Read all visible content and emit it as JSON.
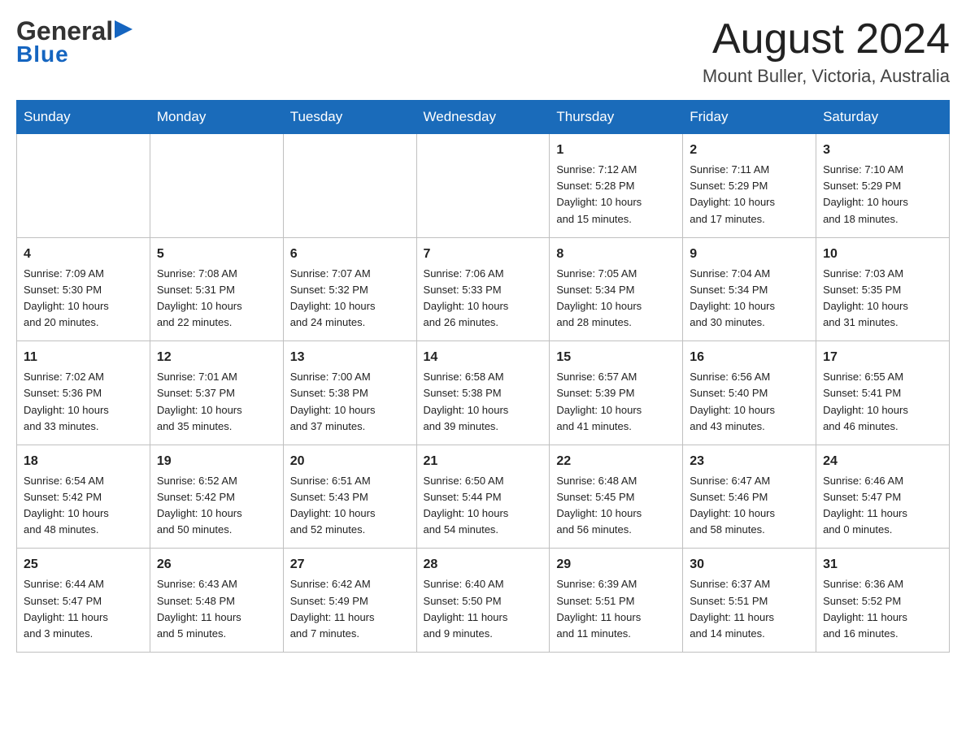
{
  "header": {
    "logo_general": "General",
    "logo_blue": "Blue",
    "month_title": "August 2024",
    "location": "Mount Buller, Victoria, Australia"
  },
  "days_of_week": [
    "Sunday",
    "Monday",
    "Tuesday",
    "Wednesday",
    "Thursday",
    "Friday",
    "Saturday"
  ],
  "weeks": [
    [
      {
        "day": "",
        "info": ""
      },
      {
        "day": "",
        "info": ""
      },
      {
        "day": "",
        "info": ""
      },
      {
        "day": "",
        "info": ""
      },
      {
        "day": "1",
        "info": "Sunrise: 7:12 AM\nSunset: 5:28 PM\nDaylight: 10 hours\nand 15 minutes."
      },
      {
        "day": "2",
        "info": "Sunrise: 7:11 AM\nSunset: 5:29 PM\nDaylight: 10 hours\nand 17 minutes."
      },
      {
        "day": "3",
        "info": "Sunrise: 7:10 AM\nSunset: 5:29 PM\nDaylight: 10 hours\nand 18 minutes."
      }
    ],
    [
      {
        "day": "4",
        "info": "Sunrise: 7:09 AM\nSunset: 5:30 PM\nDaylight: 10 hours\nand 20 minutes."
      },
      {
        "day": "5",
        "info": "Sunrise: 7:08 AM\nSunset: 5:31 PM\nDaylight: 10 hours\nand 22 minutes."
      },
      {
        "day": "6",
        "info": "Sunrise: 7:07 AM\nSunset: 5:32 PM\nDaylight: 10 hours\nand 24 minutes."
      },
      {
        "day": "7",
        "info": "Sunrise: 7:06 AM\nSunset: 5:33 PM\nDaylight: 10 hours\nand 26 minutes."
      },
      {
        "day": "8",
        "info": "Sunrise: 7:05 AM\nSunset: 5:34 PM\nDaylight: 10 hours\nand 28 minutes."
      },
      {
        "day": "9",
        "info": "Sunrise: 7:04 AM\nSunset: 5:34 PM\nDaylight: 10 hours\nand 30 minutes."
      },
      {
        "day": "10",
        "info": "Sunrise: 7:03 AM\nSunset: 5:35 PM\nDaylight: 10 hours\nand 31 minutes."
      }
    ],
    [
      {
        "day": "11",
        "info": "Sunrise: 7:02 AM\nSunset: 5:36 PM\nDaylight: 10 hours\nand 33 minutes."
      },
      {
        "day": "12",
        "info": "Sunrise: 7:01 AM\nSunset: 5:37 PM\nDaylight: 10 hours\nand 35 minutes."
      },
      {
        "day": "13",
        "info": "Sunrise: 7:00 AM\nSunset: 5:38 PM\nDaylight: 10 hours\nand 37 minutes."
      },
      {
        "day": "14",
        "info": "Sunrise: 6:58 AM\nSunset: 5:38 PM\nDaylight: 10 hours\nand 39 minutes."
      },
      {
        "day": "15",
        "info": "Sunrise: 6:57 AM\nSunset: 5:39 PM\nDaylight: 10 hours\nand 41 minutes."
      },
      {
        "day": "16",
        "info": "Sunrise: 6:56 AM\nSunset: 5:40 PM\nDaylight: 10 hours\nand 43 minutes."
      },
      {
        "day": "17",
        "info": "Sunrise: 6:55 AM\nSunset: 5:41 PM\nDaylight: 10 hours\nand 46 minutes."
      }
    ],
    [
      {
        "day": "18",
        "info": "Sunrise: 6:54 AM\nSunset: 5:42 PM\nDaylight: 10 hours\nand 48 minutes."
      },
      {
        "day": "19",
        "info": "Sunrise: 6:52 AM\nSunset: 5:42 PM\nDaylight: 10 hours\nand 50 minutes."
      },
      {
        "day": "20",
        "info": "Sunrise: 6:51 AM\nSunset: 5:43 PM\nDaylight: 10 hours\nand 52 minutes."
      },
      {
        "day": "21",
        "info": "Sunrise: 6:50 AM\nSunset: 5:44 PM\nDaylight: 10 hours\nand 54 minutes."
      },
      {
        "day": "22",
        "info": "Sunrise: 6:48 AM\nSunset: 5:45 PM\nDaylight: 10 hours\nand 56 minutes."
      },
      {
        "day": "23",
        "info": "Sunrise: 6:47 AM\nSunset: 5:46 PM\nDaylight: 10 hours\nand 58 minutes."
      },
      {
        "day": "24",
        "info": "Sunrise: 6:46 AM\nSunset: 5:47 PM\nDaylight: 11 hours\nand 0 minutes."
      }
    ],
    [
      {
        "day": "25",
        "info": "Sunrise: 6:44 AM\nSunset: 5:47 PM\nDaylight: 11 hours\nand 3 minutes."
      },
      {
        "day": "26",
        "info": "Sunrise: 6:43 AM\nSunset: 5:48 PM\nDaylight: 11 hours\nand 5 minutes."
      },
      {
        "day": "27",
        "info": "Sunrise: 6:42 AM\nSunset: 5:49 PM\nDaylight: 11 hours\nand 7 minutes."
      },
      {
        "day": "28",
        "info": "Sunrise: 6:40 AM\nSunset: 5:50 PM\nDaylight: 11 hours\nand 9 minutes."
      },
      {
        "day": "29",
        "info": "Sunrise: 6:39 AM\nSunset: 5:51 PM\nDaylight: 11 hours\nand 11 minutes."
      },
      {
        "day": "30",
        "info": "Sunrise: 6:37 AM\nSunset: 5:51 PM\nDaylight: 11 hours\nand 14 minutes."
      },
      {
        "day": "31",
        "info": "Sunrise: 6:36 AM\nSunset: 5:52 PM\nDaylight: 11 hours\nand 16 minutes."
      }
    ]
  ]
}
